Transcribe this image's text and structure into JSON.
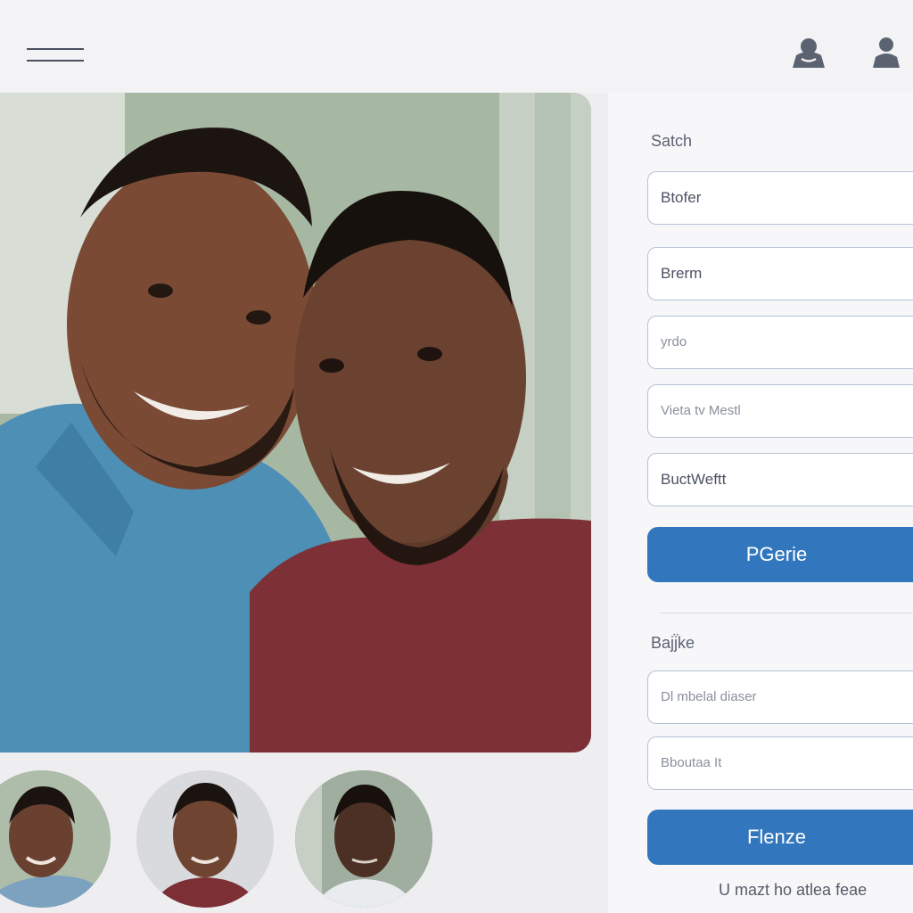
{
  "header": {
    "menu_icon": "hamburger-menu-icon",
    "icons": [
      "user-badge-icon",
      "user-icon"
    ]
  },
  "photo": {
    "alt_subject": "two-smiling-men-portrait"
  },
  "thumbnails": [
    "thumbnail-portrait-1",
    "thumbnail-portrait-2",
    "thumbnail-portrait-3"
  ],
  "search": {
    "heading": "Satch",
    "fields": [
      "Btofer",
      "Brerm",
      "yrdo",
      "Vieta tv Mestl",
      "BuctWeftt"
    ],
    "button_label": "PGerie"
  },
  "bajjke": {
    "heading": "Bajj̈ke",
    "fields": [
      "Dl mbelal diaser",
      "Bboutaa It"
    ],
    "button_label": "Flenze",
    "footnote": "U mazt ho atlea feae"
  },
  "colors": {
    "accent": "#3277bd",
    "field_border": "#b7c3d6",
    "background": "#eeeef1"
  }
}
